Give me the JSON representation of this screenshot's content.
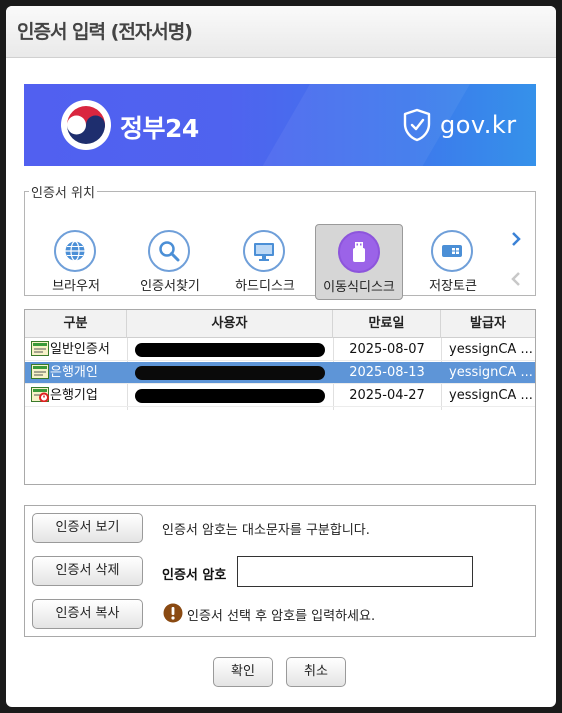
{
  "window": {
    "title": "인증서 입력 (전자서명)"
  },
  "banner": {
    "brand": "정부24",
    "domain": "gov.kr"
  },
  "location": {
    "legend": "인증서 위치",
    "items": [
      {
        "label": "브라우저",
        "icon": "globe-icon",
        "selected": false
      },
      {
        "label": "인증서찾기",
        "icon": "magnifier-icon",
        "selected": false
      },
      {
        "label": "하드디스크",
        "icon": "monitor-icon",
        "selected": false
      },
      {
        "label": "이동식디스크",
        "icon": "usb-drive-icon",
        "selected": true
      },
      {
        "label": "저장토큰",
        "icon": "token-icon",
        "selected": false
      }
    ]
  },
  "table": {
    "headers": [
      "구분",
      "사용자",
      "만료일",
      "발급자"
    ],
    "rows": [
      {
        "type": "일반인증서",
        "expiry": "2025-08-07",
        "issuer": "yessignCA ...",
        "selected": false,
        "expired_mark": false
      },
      {
        "type": "은행개인",
        "expiry": "2025-08-13",
        "issuer": "yessignCA ...",
        "selected": true,
        "expired_mark": false
      },
      {
        "type": "은행기업",
        "expiry": "2025-04-27",
        "issuer": "yessignCA ...",
        "selected": false,
        "expired_mark": true
      }
    ]
  },
  "actions": {
    "view_label": "인증서 보기",
    "delete_label": "인증서 삭제",
    "copy_label": "인증서 복사",
    "case_note": "인증서 암호는 대소문자를 구분합니다.",
    "password_label": "인증서 암호",
    "password_value": "",
    "hint": "인증서 선택 후 암호를 입력하세요."
  },
  "footer": {
    "ok_label": "확인",
    "cancel_label": "취소"
  },
  "colors": {
    "banner_start": "#5160f0",
    "banner_end": "#3591ea",
    "selection": "#5e95d7",
    "icon_ring": "#6f9fd9"
  }
}
